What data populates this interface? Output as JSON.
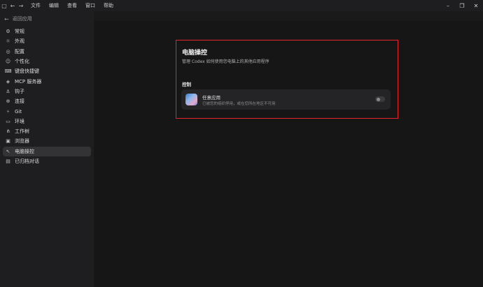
{
  "titlebar": {
    "menu": [
      "文件",
      "编辑",
      "查看",
      "窗口",
      "帮助"
    ]
  },
  "sidebar": {
    "back_label": "返回应用",
    "items": [
      {
        "label": "常规",
        "icon": "gear-icon"
      },
      {
        "label": "外观",
        "icon": "sun-icon"
      },
      {
        "label": "配置",
        "icon": "config-icon"
      },
      {
        "label": "个性化",
        "icon": "smile-icon"
      },
      {
        "label": "键盘快捷键",
        "icon": "keyboard-icon"
      },
      {
        "label": "MCP 服务器",
        "icon": "server-icon"
      },
      {
        "label": "钩子",
        "icon": "hook-icon"
      },
      {
        "label": "连接",
        "icon": "globe-icon"
      },
      {
        "label": "Git",
        "icon": "git-icon"
      },
      {
        "label": "环境",
        "icon": "terminal-icon"
      },
      {
        "label": "工作树",
        "icon": "tree-icon"
      },
      {
        "label": "浏览器",
        "icon": "browser-icon"
      },
      {
        "label": "电脑操控",
        "icon": "cursor-icon",
        "active": true
      },
      {
        "label": "已归档对话",
        "icon": "archive-icon"
      }
    ]
  },
  "main": {
    "title": "电脑操控",
    "subtitle": "管理 Codex 如何使用您电脑上的其他应用程序",
    "section_label": "控制",
    "card": {
      "title": "任意应用",
      "description": "已被您的组织停用，或在您所在地区不可用",
      "toggle_on": false
    }
  },
  "colors": {
    "highlight_border": "#e8252b",
    "background": "#161617",
    "sidebar": "#1e1e20"
  }
}
